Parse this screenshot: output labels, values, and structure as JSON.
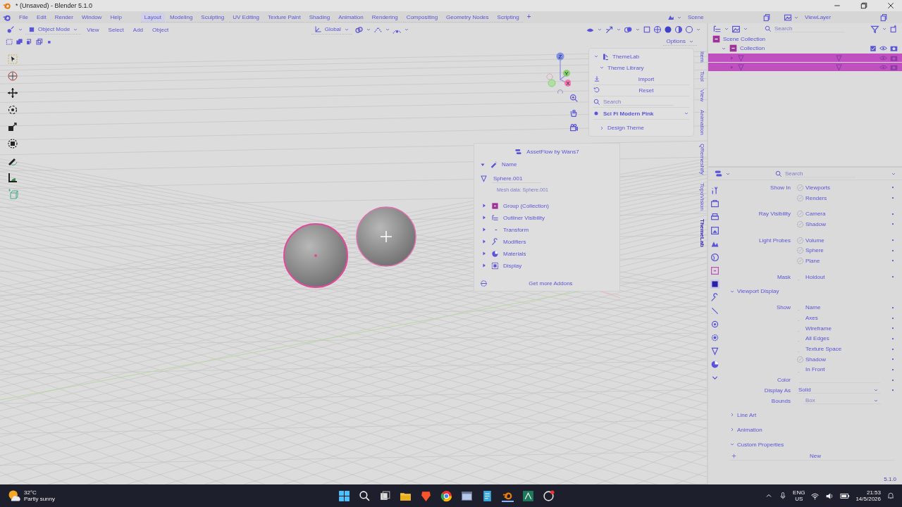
{
  "window": {
    "title": "* (Unsaved) - Blender 5.1.0"
  },
  "menu": [
    "File",
    "Edit",
    "Render",
    "Window",
    "Help"
  ],
  "workspaces": [
    {
      "label": "Layout",
      "selected": true
    },
    {
      "label": "Modeling",
      "selected": false
    },
    {
      "label": "Sculpting",
      "selected": false
    },
    {
      "label": "UV Editing",
      "selected": false
    },
    {
      "label": "Texture Paint",
      "selected": false
    },
    {
      "label": "Shading",
      "selected": false
    },
    {
      "label": "Animation",
      "selected": false
    },
    {
      "label": "Rendering",
      "selected": false
    },
    {
      "label": "Compositing",
      "selected": false
    },
    {
      "label": "Geometry Nodes",
      "selected": false
    },
    {
      "label": "Scripting",
      "selected": false
    }
  ],
  "add_workspace": "+",
  "scene": "Scene",
  "view_layer": "ViewLayer",
  "viewport_header": {
    "mode": "Object Mode",
    "menus": [
      "View",
      "Select",
      "Add",
      "Object"
    ],
    "orientation": "Global",
    "options": "Options"
  },
  "gizmo": {
    "axes": [
      "Z",
      "Y",
      "X"
    ]
  },
  "side_tabs": [
    {
      "label": "Item",
      "selected": false
    },
    {
      "label": "Tool",
      "selected": false
    },
    {
      "label": "View",
      "selected": false
    },
    {
      "label": "Animation",
      "selected": false
    },
    {
      "label": "QRemeshify",
      "selected": false
    },
    {
      "label": "TopoVision",
      "selected": false
    },
    {
      "label": "ThemeLab",
      "selected": true
    }
  ],
  "themelab": {
    "title": "ThemeLab",
    "section": "Theme Library",
    "buttons": [
      {
        "kind": "import",
        "label": "Import"
      },
      {
        "kind": "reset",
        "label": "Reset"
      }
    ],
    "search_placeholder": "Search",
    "theme": "Sci Fi Modern Pink",
    "subsection": "Design Theme"
  },
  "assetflow": {
    "title": "AssetFlow by Wans7",
    "name_header": "Name",
    "object_name": "Sphere.001",
    "mesh_data": "Mesh data: Sphere.001",
    "sections": [
      {
        "kind": "collection",
        "label": "Group (Collection)"
      },
      {
        "kind": "outliner",
        "label": "Outliner Visibility"
      },
      {
        "kind": "transform",
        "label": "Transform"
      },
      {
        "kind": "modifiers",
        "label": "Modifiers"
      },
      {
        "kind": "materials",
        "label": "Materials"
      },
      {
        "kind": "display",
        "label": "Display"
      }
    ],
    "footer": "Get more Addons"
  },
  "outliner": {
    "search_placeholder": "Search",
    "tree": [
      {
        "label": "Scene Collection",
        "children": [
          {
            "label": "Collection",
            "expanded": true,
            "children": [
              {
                "kind": "mesh",
                "selected": true
              },
              {
                "kind": "mesh",
                "selected": true
              }
            ]
          }
        ]
      }
    ]
  },
  "properties": {
    "search_placeholder": "Search",
    "tabs": [
      {
        "kind": "tool",
        "selected": false
      },
      {
        "kind": "render",
        "selected": false
      },
      {
        "kind": "output",
        "selected": false
      },
      {
        "kind": "view",
        "selected": false
      },
      {
        "kind": "scene",
        "selected": false
      },
      {
        "kind": "world",
        "selected": false
      },
      {
        "kind": "collection",
        "selected": false
      },
      {
        "kind": "object",
        "selected": true
      },
      {
        "kind": "modifier",
        "selected": false
      },
      {
        "kind": "particles",
        "selected": false
      },
      {
        "kind": "physics",
        "selected": false
      },
      {
        "kind": "constraint",
        "selected": false
      },
      {
        "kind": "data",
        "selected": false
      },
      {
        "kind": "material",
        "selected": false
      },
      {
        "kind": "more",
        "selected": false
      }
    ],
    "rows": [
      {
        "kind": "check",
        "label": "Show In",
        "option": "Viewports",
        "checked": true
      },
      {
        "kind": "check",
        "option": "Renders",
        "checked": true
      },
      {
        "kind": "check",
        "label": "Ray Visibility",
        "option": "Camera",
        "checked": true
      },
      {
        "kind": "check",
        "option": "Shadow",
        "checked": true
      },
      {
        "kind": "check",
        "label": "Light Probes",
        "option": "Volume",
        "checked": true
      },
      {
        "kind": "check",
        "option": "Sphere",
        "checked": true
      },
      {
        "kind": "check",
        "option": "Plane",
        "checked": true
      },
      {
        "kind": "check",
        "label": "Mask",
        "option": "Holdout",
        "checked": false
      },
      {
        "kind": "section",
        "label": "Viewport Display",
        "expanded": true
      },
      {
        "kind": "check",
        "label": "Show",
        "option": "Name",
        "checked": false
      },
      {
        "kind": "check",
        "option": "Axes",
        "checked": false
      },
      {
        "kind": "check",
        "option": "Wireframe",
        "checked": false
      },
      {
        "kind": "check",
        "option": "All Edges",
        "checked": false
      },
      {
        "kind": "check",
        "option": "Texture Space",
        "checked": false
      },
      {
        "kind": "check",
        "option": "Shadow",
        "checked": true
      },
      {
        "kind": "check",
        "option": "In Front",
        "checked": false
      },
      {
        "kind": "color",
        "label": "Color"
      },
      {
        "kind": "dropdown",
        "label": "Display As",
        "value": "Solid",
        "disabled": false
      },
      {
        "kind": "dropdown",
        "label": "Bounds",
        "value": "Box",
        "disabled": true
      },
      {
        "kind": "section",
        "label": "Line Art",
        "expanded": false
      },
      {
        "kind": "section",
        "label": "Animation",
        "expanded": false
      },
      {
        "kind": "section",
        "label": "Custom Properties",
        "expanded": true
      },
      {
        "kind": "button",
        "label": "New"
      }
    ]
  },
  "version": "5.1.0",
  "taskbar": {
    "temperature": "32°C",
    "weather": "Partly sunny",
    "language": "ENG",
    "region": "US",
    "time": "21:53",
    "date": "14/5/2026"
  }
}
